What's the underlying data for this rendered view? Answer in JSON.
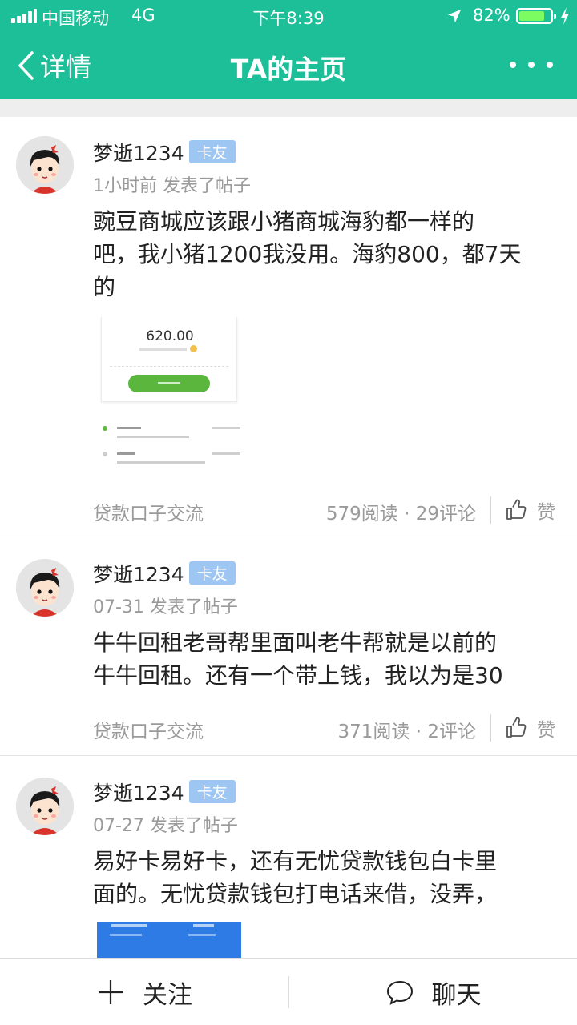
{
  "status_bar": {
    "carrier": "中国移动",
    "network": "4G",
    "time": "下午8:39",
    "battery_percent": "82%",
    "battery_level": 0.82,
    "icons": [
      "signal-icon",
      "location-arrow-icon",
      "battery-icon",
      "charging-bolt-icon"
    ]
  },
  "nav": {
    "back_label": "详情",
    "title": "TA的主页",
    "icons": [
      "back-chevron-icon",
      "more-dots-icon"
    ]
  },
  "posts": [
    {
      "username": "梦逝1234",
      "badge": "卡友",
      "meta": "1小时前 发表了帖子",
      "text": "豌豆商城应该跟小猪商城海豹都一样的\n吧，我小猪1200我没用。海豹800，都7天\n的",
      "image_amount": "620.00",
      "board": "贷款口子交流",
      "stats": "579阅读 · 29评论",
      "like_label": "赞"
    },
    {
      "username": "梦逝1234",
      "badge": "卡友",
      "meta": "07-31 发表了帖子",
      "text": "牛牛回租老哥帮里面叫老牛帮就是以前的\n牛牛回租。还有一个带上钱，我以为是30",
      "board": "贷款口子交流",
      "stats": "371阅读 · 2评论",
      "like_label": "赞"
    },
    {
      "username": "梦逝1234",
      "badge": "卡友",
      "meta": "07-27 发表了帖子",
      "text": "易好卡易好卡，还有无忧贷款钱包白卡里\n面的。无忧贷款钱包打电话来借，没弄，"
    }
  ],
  "bottom_bar": {
    "follow_label": "关注",
    "chat_label": "聊天",
    "icons": [
      "plus-icon",
      "chat-bubble-icon"
    ]
  },
  "colors": {
    "brand": "#1DBF98",
    "badge": "#9EC6F3",
    "muted_text": "#9a9a9a"
  }
}
